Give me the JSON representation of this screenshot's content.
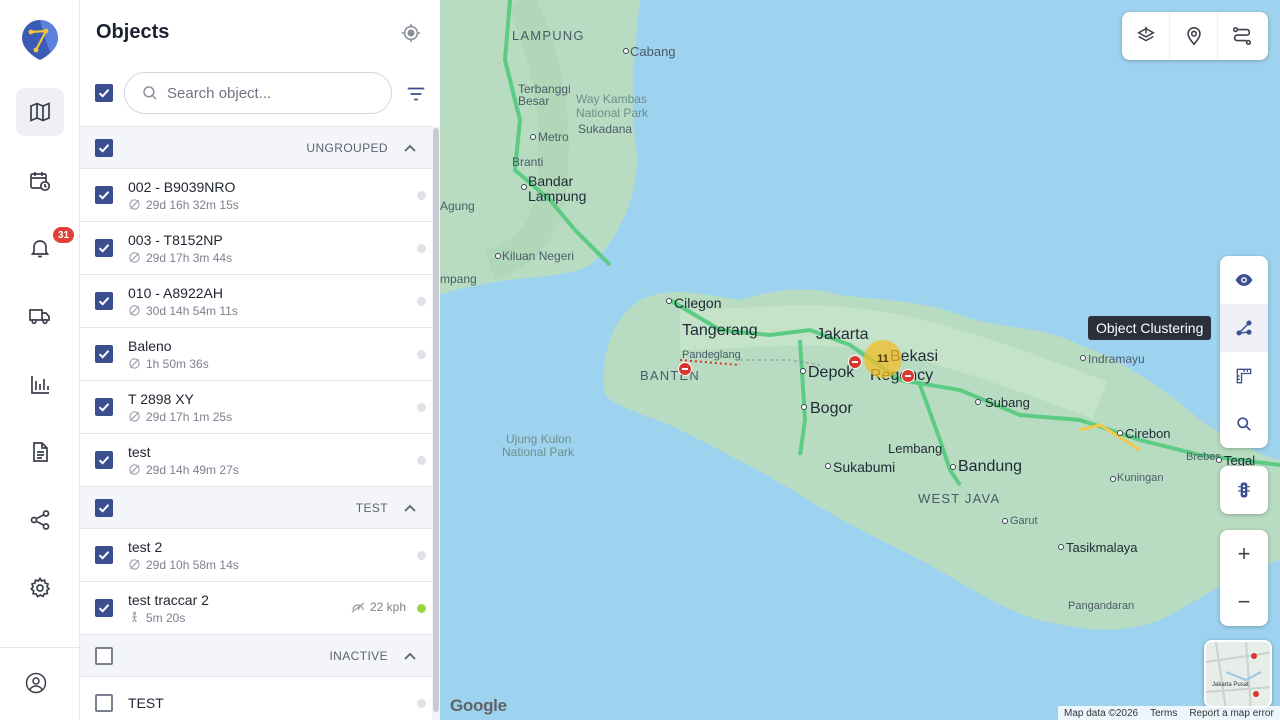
{
  "rail": {
    "notifications_badge": "31"
  },
  "panel": {
    "title": "Objects",
    "search_placeholder": "Search object..."
  },
  "groups": [
    {
      "name": "UNGROUPED",
      "checked": true,
      "items": [
        {
          "name": "002 - B9039NRO",
          "time": "29d 16h 32m 15s",
          "checked": true
        },
        {
          "name": "003 - T8152NP",
          "time": "29d 17h 3m 44s",
          "checked": true
        },
        {
          "name": "010 - A8922AH",
          "time": "30d 14h 54m 11s",
          "checked": true
        },
        {
          "name": "Baleno",
          "time": "1h 50m 36s",
          "checked": true
        },
        {
          "name": "T 2898 XY",
          "time": "29d 17h 1m 25s",
          "checked": true
        },
        {
          "name": "test",
          "time": "29d 14h 49m 27s",
          "checked": true
        }
      ]
    },
    {
      "name": "TEST",
      "checked": true,
      "items": [
        {
          "name": "test 2",
          "time": "29d 10h 58m 14s",
          "checked": true
        },
        {
          "name": "test traccar 2",
          "time": "5m 20s",
          "checked": true,
          "speed": "22 kph",
          "online": true
        }
      ]
    },
    {
      "name": "INACTIVE",
      "checked": false,
      "items": [
        {
          "name": "TEST",
          "time": "",
          "checked": false
        }
      ]
    }
  ],
  "map": {
    "labels": {
      "lampung": "LAMPUNG",
      "cabang": "Cabang",
      "terbanggi": "Terbanggi",
      "besar": "Besar",
      "way_kambas": "Way Kambas",
      "national_park": "National Park",
      "sukadana": "Sukadana",
      "metro": "Metro",
      "branti": "Branti",
      "bandar": "Bandar",
      "lampung_city": "Lampung",
      "agung": "Agung",
      "kiluan": "Kiluan Negeri",
      "mpang": "mpang",
      "cilegon": "Cilegon",
      "tangerang": "Tangerang",
      "jakarta": "Jakarta",
      "bekasi": "Bekasi",
      "regency": "Regency",
      "pandeglang": "Pandeglang",
      "banten": "BANTEN",
      "depok": "Depok",
      "bogor": "Bogor",
      "ujung_kulon": "Ujung Kulon",
      "ujung_park": "National Park",
      "sukabumi": "Sukabumi",
      "lembang": "Lembang",
      "bandung": "Bandung",
      "west_java": "WEST JAVA",
      "subang": "Subang",
      "indramayu": "Indramayu",
      "cirebon": "Cirebon",
      "brebes": "Brebes",
      "tegal": "Tegal",
      "kuningan": "Kuningan",
      "garut": "Garut",
      "tasikmalaya": "Tasikmalaya",
      "pangandaran": "Pangandaran"
    },
    "cluster_count": "11",
    "tooltip": "Object Clustering",
    "zoom_in": "+",
    "zoom_out": "−",
    "google": "Google",
    "attribution": {
      "data": "Map data ©2026",
      "terms": "Terms",
      "report": "Report a map error"
    },
    "minimap_label": "Jakarta Pusat"
  }
}
